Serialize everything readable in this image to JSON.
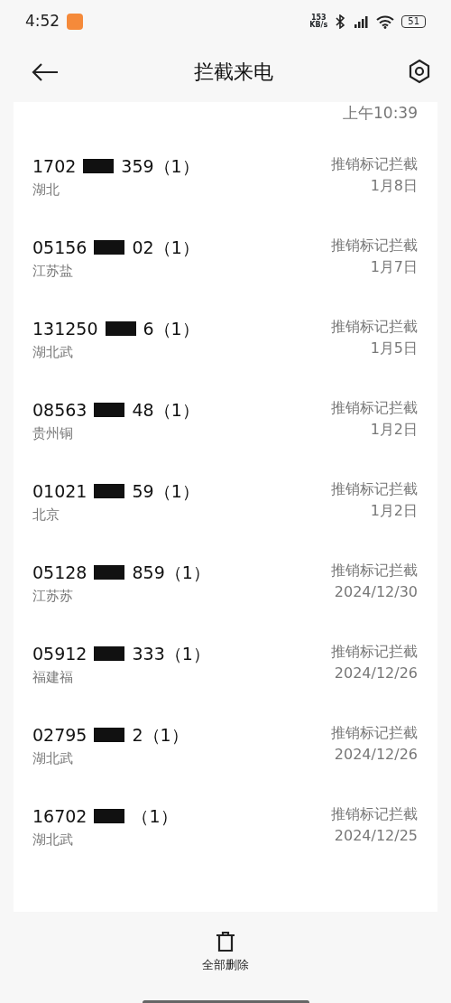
{
  "status_bar": {
    "time": "4:52",
    "net_speed_value": "153",
    "net_speed_unit": "KB/s",
    "battery": "51"
  },
  "header": {
    "title": "拦截来电"
  },
  "top_time": "上午10:39",
  "calls": [
    {
      "number_start": "1702",
      "number_end": "359（1）",
      "location": "湖北",
      "reason": "推销标记拦截",
      "date": "1月8日"
    },
    {
      "number_start": "05156",
      "number_end": "02（1）",
      "location": "江苏盐",
      "reason": "推销标记拦截",
      "date": "1月7日"
    },
    {
      "number_start": "131250",
      "number_end": "6（1）",
      "location": "湖北武",
      "reason": "推销标记拦截",
      "date": "1月5日"
    },
    {
      "number_start": "08563",
      "number_end": "48（1）",
      "location": "贵州铜",
      "reason": "推销标记拦截",
      "date": "1月2日"
    },
    {
      "number_start": "01021",
      "number_end": "59（1）",
      "location": "北京",
      "reason": "推销标记拦截",
      "date": "1月2日"
    },
    {
      "number_start": "05128",
      "number_end": "859（1）",
      "location": "江苏苏",
      "reason": "推销标记拦截",
      "date": "2024/12/30"
    },
    {
      "number_start": "05912",
      "number_end": "333（1）",
      "location": "福建福",
      "reason": "推销标记拦截",
      "date": "2024/12/26"
    },
    {
      "number_start": "02795",
      "number_end": "2（1）",
      "location": "湖北武",
      "reason": "推销标记拦截",
      "date": "2024/12/26"
    },
    {
      "number_start": "16702",
      "number_end": "（1）",
      "location": "湖北武",
      "reason": "推销标记拦截",
      "date": "2024/12/25"
    }
  ],
  "bottom_action": {
    "label": "全部删除"
  }
}
